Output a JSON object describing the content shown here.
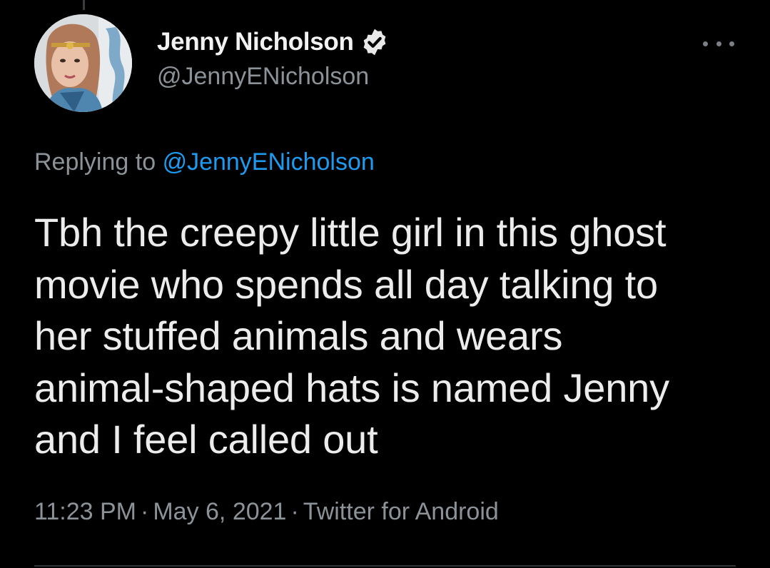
{
  "tweet": {
    "author": {
      "display_name": "Jenny Nicholson",
      "handle": "@JennyENicholson",
      "verified": true
    },
    "replying_to": {
      "prefix": "Replying to",
      "handle": "@JennyENicholson"
    },
    "text_lines": [
      "Tbh the creepy little girl in this ghost",
      "movie who spends all day talking to",
      "her stuffed animals and wears",
      "animal-shaped hats is named Jenny",
      "and I feel called out"
    ],
    "time": "11:23 PM",
    "separator": "·",
    "date": "May 6, 2021",
    "source": "Twitter for Android"
  },
  "icons": {
    "verified": "verified-badge-icon",
    "more": "more-options-icon"
  },
  "colors": {
    "background": "#000000",
    "primary_text": "#ececec",
    "secondary_text": "#8b9298",
    "link": "#1d9bf0",
    "divider": "#2f3336"
  }
}
